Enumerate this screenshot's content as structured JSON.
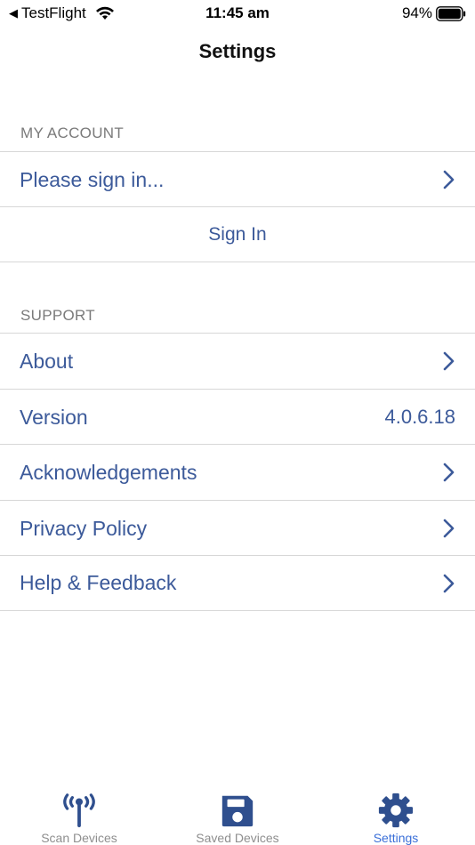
{
  "status_bar": {
    "back_app": "TestFlight",
    "time": "11:45 am",
    "battery": "94%"
  },
  "nav": {
    "title": "Settings"
  },
  "sections": {
    "account": {
      "header": "MY ACCOUNT",
      "signin_prompt": "Please sign in...",
      "signin_button": "Sign In"
    },
    "support": {
      "header": "SUPPORT",
      "about": "About",
      "version_label": "Version",
      "version_value": "4.0.6.18",
      "acknowledgements": "Acknowledgements",
      "privacy": "Privacy Policy",
      "help": "Help & Feedback"
    }
  },
  "tabs": {
    "scan": "Scan Devices",
    "saved": "Saved Devices",
    "settings": "Settings"
  },
  "colors": {
    "link": "#3c5a9a",
    "tab_active": "#3a6fd8",
    "tab_icon": "#2f4f8e"
  }
}
